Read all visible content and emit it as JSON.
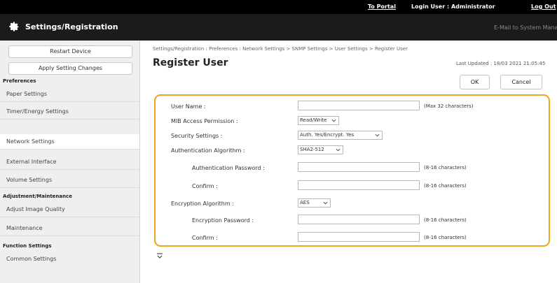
{
  "topbar": {
    "to_portal": "To Portal",
    "login_user": "Login User :  Administrator",
    "logout": "Log Out"
  },
  "header": {
    "title": "Settings/Registration",
    "mail_link": "E-Mail to System Manager",
    "icon": "gear-icon"
  },
  "sidebar": {
    "restart_label": "Restart Device",
    "apply_label": "Apply Setting Changes",
    "sections": [
      {
        "heading": "Preferences",
        "items": [
          "Paper Settings",
          "Timer/Energy Settings",
          "Network Settings",
          "External Interface",
          "Volume Settings"
        ]
      },
      {
        "heading": "Adjustment/Maintenance",
        "items": [
          "Adjust Image Quality",
          "Maintenance"
        ]
      },
      {
        "heading": "Function Settings",
        "items": [
          "Common Settings"
        ]
      }
    ],
    "active_item": "Network Settings"
  },
  "main": {
    "breadcrumb": "Settings/Registration : Preferences : Network Settings > SNMP Settings > User Settings > Register User",
    "title": "Register User",
    "last_updated": "Last Updated : 18/03 2021 21:05:45",
    "ok_label": "OK",
    "cancel_label": "Cancel",
    "form": {
      "user_name_label": "User Name :",
      "user_name_value": "",
      "user_name_hint": "(Max 32 characters)",
      "mib_label": "MIB Access Permission :",
      "mib_value": "Read/Write",
      "security_label": "Security Settings :",
      "security_value": "Auth. Yes/Encrypt. Yes",
      "auth_algo_label": "Authentication Algorithm :",
      "auth_algo_value": "SHA2-512",
      "auth_pw_label": "Authentication Password :",
      "auth_pw_hint": "(8-16 characters)",
      "auth_confirm_label": "Confirm :",
      "auth_confirm_hint": "(8-16 characters)",
      "enc_algo_label": "Encryption Algorithm :",
      "enc_algo_value": "AES",
      "enc_pw_label": "Encryption Password :",
      "enc_pw_hint": "(8-16 characters)",
      "enc_confirm_label": "Confirm :",
      "enc_confirm_hint": "(8-16 characters)"
    }
  },
  "colors": {
    "form_border": "#f2a31d",
    "header_bg": "#1b1b1b",
    "topbar_bg": "#000000"
  }
}
